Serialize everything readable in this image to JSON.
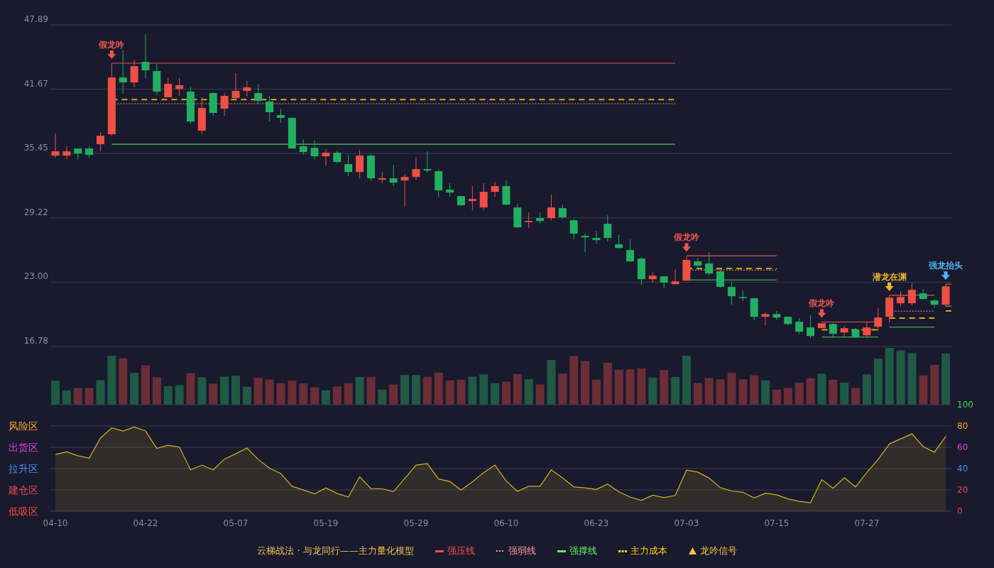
{
  "price_chart": {
    "chart_data": {
      "type": "candlestick",
      "ylim": [
        16.78,
        47.89
      ],
      "grid": true,
      "yticks": [
        47.89,
        41.67,
        35.45,
        29.22,
        {
          "value": 23,
          "label": "23.00"
        },
        16.78
      ],
      "categories": [
        null,
        null,
        null,
        null,
        null,
        null,
        null,
        null,
        null,
        null,
        null,
        null,
        null,
        null,
        null,
        null,
        null,
        null,
        null,
        null,
        null,
        null,
        null,
        null,
        null,
        null,
        null,
        null,
        null,
        null,
        null,
        null,
        null,
        null,
        null,
        null,
        null,
        null,
        null,
        null,
        null,
        null,
        null,
        null,
        null,
        null,
        null,
        null,
        null,
        null,
        null,
        null,
        null,
        null,
        null,
        null,
        null,
        null,
        null,
        null,
        null,
        null,
        null,
        null,
        null,
        null,
        null,
        null,
        null,
        null,
        null,
        null,
        null,
        null,
        null,
        null,
        null,
        null,
        null,
        null
      ],
      "ohlc": [
        [
          35.24,
          37.37,
          35.04,
          35.66
        ],
        [
          35.24,
          36.14,
          34.9,
          35.66
        ],
        [
          35.93,
          35.93,
          34.9,
          35.45
        ],
        [
          35.93,
          36.14,
          35.04,
          35.31
        ],
        [
          36.34,
          37.51,
          35.66,
          37.17
        ],
        [
          37.31,
          44.18,
          37.17,
          42.8
        ],
        [
          42.8,
          45.48,
          41.22,
          42.32
        ],
        [
          42.32,
          44.52,
          41.84,
          43.9
        ],
        [
          44.31,
          46.99,
          42.73,
          43.49
        ],
        [
          43.42,
          44.11,
          41.08,
          41.43
        ],
        [
          40.88,
          42.73,
          40.88,
          42.18
        ],
        [
          41.7,
          42.73,
          41.02,
          42.05
        ],
        [
          41.43,
          41.91,
          38.34,
          38.54
        ],
        [
          37.65,
          40.88,
          37.37,
          39.85
        ],
        [
          41.29,
          41.36,
          39.09,
          39.37
        ],
        [
          39.78,
          41.29,
          39.09,
          41.02
        ],
        [
          40.81,
          43.21,
          40.67,
          41.5
        ],
        [
          41.5,
          42.46,
          40.95,
          41.84
        ],
        [
          41.29,
          42.18,
          40.26,
          40.53
        ],
        [
          40.47,
          41.02,
          38.54,
          39.44
        ],
        [
          39.16,
          39.78,
          38.4,
          38.89
        ],
        [
          38.89,
          38.95,
          35.93,
          35.93
        ],
        [
          36.14,
          36.82,
          35.31,
          35.59
        ],
        [
          36.0,
          36.69,
          34.9,
          35.18
        ],
        [
          35.18,
          35.86,
          34.28,
          35.52
        ],
        [
          35.52,
          35.73,
          34.49,
          34.63
        ],
        [
          34.42,
          35.31,
          33.25,
          33.66
        ],
        [
          33.66,
          35.79,
          33.05,
          35.24
        ],
        [
          35.24,
          35.38,
          32.77,
          33.05
        ],
        [
          32.91,
          33.66,
          32.57,
          33.05
        ],
        [
          33.05,
          34.35,
          32.29,
          32.63
        ],
        [
          32.84,
          33.46,
          30.37,
          33.18
        ],
        [
          33.18,
          35.11,
          32.91,
          33.94
        ],
        [
          33.94,
          35.66,
          33.6,
          33.8
        ],
        [
          33.73,
          33.94,
          31.19,
          31.88
        ],
        [
          31.95,
          32.57,
          31.26,
          31.67
        ],
        [
          31.33,
          31.33,
          30.37,
          30.44
        ],
        [
          30.85,
          32.29,
          29.95,
          31.05
        ],
        [
          30.23,
          32.57,
          29.95,
          31.74
        ],
        [
          31.74,
          32.7,
          31.26,
          32.29
        ],
        [
          32.29,
          32.84,
          30.44,
          30.5
        ],
        [
          30.23,
          30.57,
          28.24,
          28.31
        ],
        [
          28.79,
          29.75,
          28.24,
          28.92
        ],
        [
          29.2,
          29.75,
          28.65,
          28.92
        ],
        [
          29.2,
          31.47,
          28.99,
          30.23
        ],
        [
          30.16,
          30.5,
          29.13,
          29.27
        ],
        [
          28.99,
          29.06,
          27.14,
          27.69
        ],
        [
          27.48,
          27.69,
          25.9,
          27.34
        ],
        [
          27.28,
          27.96,
          26.73,
          27.07
        ],
        [
          28.65,
          29.47,
          26.93,
          27.28
        ],
        [
          26.66,
          27.55,
          26.24,
          26.31
        ],
        [
          26.11,
          27.14,
          24.94,
          25.01
        ],
        [
          25.28,
          25.42,
          22.74,
          23.29
        ],
        [
          23.29,
          23.98,
          22.95,
          23.63
        ],
        [
          23.57,
          23.57,
          22.4,
          22.95
        ],
        [
          22.81,
          24.25,
          22.74,
          23.08
        ],
        [
          23.15,
          25.49,
          23.08,
          25.15
        ],
        [
          25.01,
          25.35,
          24.18,
          24.6
        ],
        [
          24.8,
          25.9,
          23.63,
          23.84
        ],
        [
          24.05,
          24.18,
          22.47,
          22.54
        ],
        [
          22.54,
          23.02,
          20.82,
          21.64
        ],
        [
          21.57,
          22.19,
          21.16,
          21.5
        ],
        [
          21.44,
          21.5,
          19.31,
          19.65
        ],
        [
          19.65,
          20.06,
          18.83,
          19.92
        ],
        [
          19.92,
          20.2,
          19.37,
          19.58
        ],
        [
          19.65,
          19.72,
          18.83,
          18.96
        ],
        [
          19.17,
          19.51,
          18.0,
          18.21
        ],
        [
          18.62,
          19.79,
          17.59,
          17.79
        ],
        [
          18.55,
          19.03,
          18.55,
          19.03
        ],
        [
          18.96,
          19.03,
          17.73,
          18.0
        ],
        [
          18.14,
          18.76,
          17.66,
          18.55
        ],
        [
          18.41,
          18.55,
          17.59,
          17.66
        ],
        [
          17.86,
          19.17,
          17.66,
          18.62
        ],
        [
          18.69,
          20.54,
          18.28,
          19.58
        ],
        [
          19.65,
          21.71,
          19.1,
          21.5
        ],
        [
          20.96,
          22.12,
          20.68,
          21.57
        ],
        [
          20.96,
          22.95,
          20.75,
          22.26
        ],
        [
          21.92,
          22.33,
          21.3,
          21.37
        ],
        [
          21.23,
          21.37,
          20.54,
          20.82
        ],
        [
          20.82,
          22.81,
          20.68,
          22.6
        ]
      ]
    },
    "signals": [
      {
        "label": "假龙吟",
        "color": "#f0554f"
      },
      {
        "label": "假龙吟",
        "color": "#f0554f"
      },
      {
        "label": "假龙吟",
        "color": "#f0554f"
      },
      {
        "label": "潜龙在渊",
        "color": "#f2b62e"
      },
      {
        "label": "强龙抬头",
        "color": "#4fb3f5"
      }
    ]
  },
  "indicator_chart": {
    "chart_data": {
      "type": "area",
      "ylim": [
        0,
        100
      ],
      "grid": true,
      "categories": [
        "04-10",
        null,
        null,
        null,
        null,
        null,
        null,
        null,
        "04-22",
        null,
        null,
        null,
        null,
        null,
        null,
        null,
        "05-07",
        null,
        null,
        null,
        null,
        null,
        null,
        null,
        "05-19",
        null,
        null,
        null,
        null,
        null,
        null,
        null,
        "05-29",
        null,
        null,
        null,
        null,
        null,
        null,
        null,
        "06-10",
        null,
        null,
        null,
        null,
        null,
        null,
        null,
        "06-23",
        null,
        null,
        null,
        null,
        null,
        null,
        null,
        "07-03",
        null,
        null,
        null,
        null,
        null,
        null,
        null,
        "07-15",
        null,
        null,
        null,
        null,
        null,
        null,
        null,
        "07-27",
        null,
        null,
        null,
        null,
        null,
        null,
        null
      ],
      "yticks": [
        100,
        80,
        60,
        40,
        20,
        0
      ],
      "series": [
        {
          "color": "#d4b21a",
          "values": [
            53.3,
            55.7,
            52.1,
            49.8,
            68.7,
            78.2,
            75.3,
            79.1,
            75.3,
            59.0,
            61.9,
            60.2,
            38.8,
            43.3,
            38.8,
            48.9,
            53.9,
            59.3,
            48.6,
            40.3,
            35.3,
            23.4,
            19.9,
            16.3,
            21.9,
            16.6,
            13.3,
            32.3,
            21.3,
            21.0,
            18.4,
            30.8,
            43.3,
            44.7,
            30.2,
            27.9,
            19.9,
            27.6,
            36.1,
            43.3,
            28.4,
            18.7,
            23.4,
            23.4,
            38.8,
            31.4,
            22.8,
            21.9,
            20.4,
            25.5,
            18.1,
            13.3,
            10.1,
            15.1,
            12.7,
            14.8,
            38.5,
            36.7,
            31.1,
            22.2,
            19.0,
            17.8,
            12.4,
            16.9,
            15.4,
            11.6,
            9.2,
            8.0,
            29.6,
            21.6,
            31.4,
            22.8,
            36.4,
            48.6,
            63.1,
            67.9,
            72.6,
            60.7,
            55.4,
            70.2
          ]
        }
      ]
    },
    "zones": [
      {
        "label": "风险区",
        "color": "#f5a623"
      },
      {
        "label": "出货区",
        "color": "#e040e0"
      },
      {
        "label": "拉升区",
        "color": "#4a8af0"
      },
      {
        "label": "建仓区",
        "color": "#f04848"
      },
      {
        "label": "低吸区",
        "color": "#f04848"
      }
    ]
  },
  "legend": {
    "title": "云梯战法 · 与龙同行——主力量化模型",
    "items": [
      {
        "label": "强压线",
        "kind": "solid",
        "color": "#ff4d4d"
      },
      {
        "label": "强弱线",
        "kind": "dotted",
        "color": "#ff9a9a"
      },
      {
        "label": "强撑线",
        "kind": "solid",
        "color": "#66ee66"
      },
      {
        "label": "主力成本",
        "kind": "dashed",
        "color": "#ffd700"
      },
      {
        "label": "龙吟信号",
        "kind": "triangle",
        "color": "#f5c542"
      }
    ]
  }
}
